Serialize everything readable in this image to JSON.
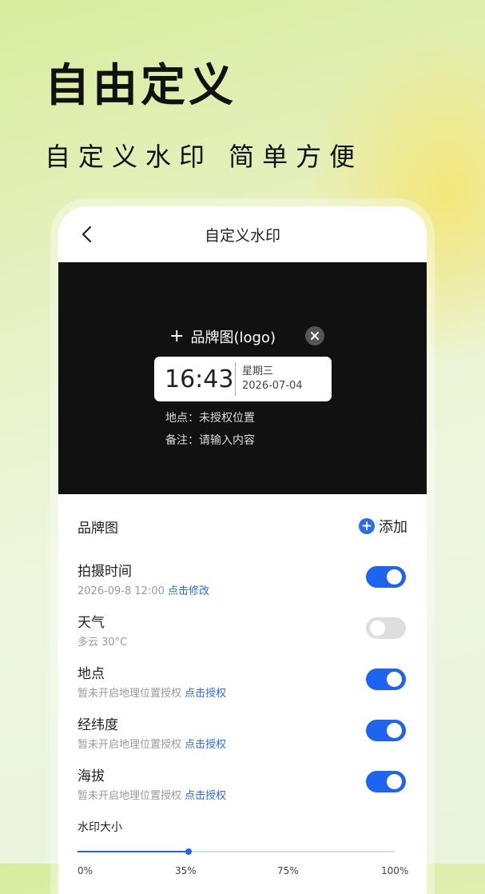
{
  "hero": {
    "title": "自由定义",
    "subtitle": "自定义水印 简单方便"
  },
  "screen": {
    "nav": {
      "title": "自定义水印",
      "back_icon": "chevron-left-icon"
    },
    "preview": {
      "brand_text": "品牌图(logo)",
      "time": "16:43",
      "weekday": "星期三",
      "date": "2026-07-04",
      "location_line": "地点：未授权位置",
      "note_line": "备注：请输入内容"
    },
    "brand_section": {
      "label": "品牌图",
      "add_label": "添加"
    },
    "settings": [
      {
        "title": "拍摄时间",
        "sub": "2026-09-8 12:00",
        "link": "点击修改",
        "on": true
      },
      {
        "title": "天气",
        "sub": "多云 30°C",
        "link": "",
        "on": false
      },
      {
        "title": "地点",
        "sub": "暂未开启地理位置授权",
        "link": "点击授权",
        "on": true
      },
      {
        "title": "经纬度",
        "sub": "暂未开启地理位置授权",
        "link": "点击授权",
        "on": true
      },
      {
        "title": "海拔",
        "sub": "暂未开启地理位置授权",
        "link": "点击授权",
        "on": true
      }
    ],
    "watermark_size": {
      "label": "水印大小",
      "value_percent": 35,
      "ticks": [
        "0%",
        "35%",
        "75%",
        "100%"
      ]
    }
  },
  "colors": {
    "accent": "#1e64f0",
    "preview_bg": "#111111"
  }
}
